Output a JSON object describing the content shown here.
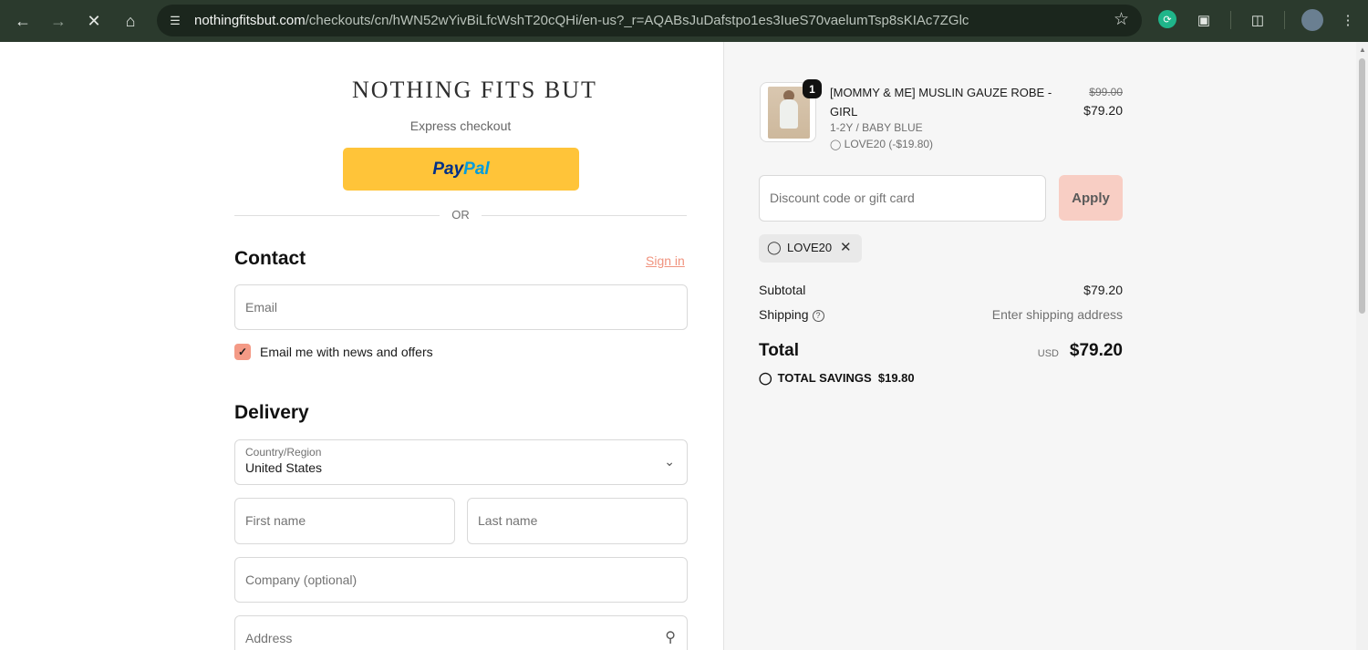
{
  "browser": {
    "url_host": "nothingfitsbut.com",
    "url_path": "/checkouts/cn/hWN52wYivBiLfcWshT20cQHi/en-us?_r=AQABsJuDafstpo1es3IueS70vaelumTsp8sKIAc7ZGlc",
    "icons": [
      "back-arrow-icon",
      "forward-arrow-icon",
      "stop-icon",
      "home-icon",
      "site-settings-icon",
      "bookmark-star-icon",
      "extension-icon",
      "puzzle-icon",
      "cast-icon",
      "profile-icon",
      "menu-dots-icon"
    ]
  },
  "checkout": {
    "store_name": "NOTHING FITS BUT",
    "express_label": "Express checkout",
    "paypal": {
      "part1": "Pay",
      "part2": "Pal"
    },
    "or_label": "OR",
    "contact": {
      "title": "Contact",
      "sign_in": "Sign in",
      "email_placeholder": "Email",
      "news_label": "Email me with news and offers",
      "news_checked": true
    },
    "delivery": {
      "title": "Delivery",
      "country_label": "Country/Region",
      "country_value": "United States",
      "first_name_placeholder": "First name",
      "last_name_placeholder": "Last name",
      "company_placeholder": "Company (optional)",
      "address_placeholder": "Address"
    }
  },
  "summary": {
    "item": {
      "quantity": "1",
      "name": "[MOMMY & ME] MUSLIN GAUZE ROBE - GIRL",
      "variant": "1-2Y / BABY BLUE",
      "discount": "LOVE20 (-$19.80)",
      "price_old": "$99.00",
      "price_new": "$79.20"
    },
    "discount_placeholder": "Discount code or gift card",
    "apply_label": "Apply",
    "applied_code": "LOVE20",
    "subtotal_label": "Subtotal",
    "subtotal_value": "$79.20",
    "shipping_label": "Shipping",
    "shipping_value": "Enter shipping address",
    "total_label": "Total",
    "total_currency": "USD",
    "total_value": "$79.20",
    "savings_label": "TOTAL SAVINGS",
    "savings_value": "$19.80"
  },
  "colors": {
    "accent": "#f0937e",
    "paypal_yellow": "#ffc439",
    "apply_bg": "#f8cec4",
    "chrome_bg": "#2b3a2d"
  }
}
